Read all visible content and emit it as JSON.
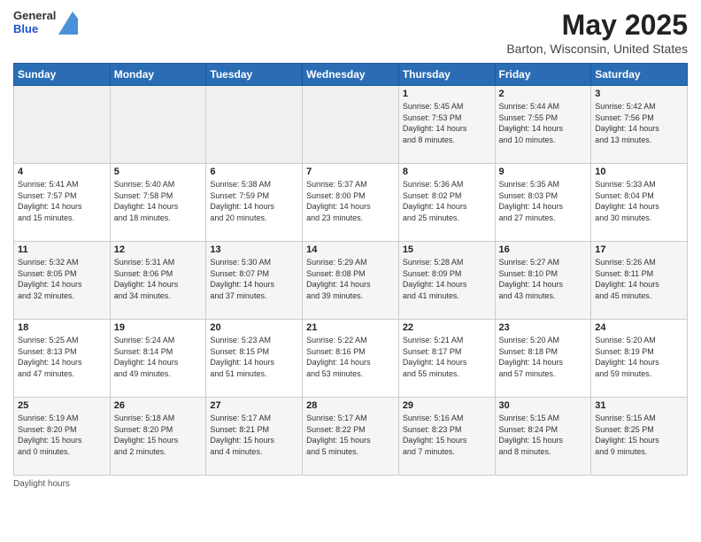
{
  "logo": {
    "general": "General",
    "blue": "Blue"
  },
  "title": "May 2025",
  "location": "Barton, Wisconsin, United States",
  "days_of_week": [
    "Sunday",
    "Monday",
    "Tuesday",
    "Wednesday",
    "Thursday",
    "Friday",
    "Saturday"
  ],
  "weeks": [
    [
      {
        "day": "",
        "info": ""
      },
      {
        "day": "",
        "info": ""
      },
      {
        "day": "",
        "info": ""
      },
      {
        "day": "",
        "info": ""
      },
      {
        "day": "1",
        "info": "Sunrise: 5:45 AM\nSunset: 7:53 PM\nDaylight: 14 hours\nand 8 minutes."
      },
      {
        "day": "2",
        "info": "Sunrise: 5:44 AM\nSunset: 7:55 PM\nDaylight: 14 hours\nand 10 minutes."
      },
      {
        "day": "3",
        "info": "Sunrise: 5:42 AM\nSunset: 7:56 PM\nDaylight: 14 hours\nand 13 minutes."
      }
    ],
    [
      {
        "day": "4",
        "info": "Sunrise: 5:41 AM\nSunset: 7:57 PM\nDaylight: 14 hours\nand 15 minutes."
      },
      {
        "day": "5",
        "info": "Sunrise: 5:40 AM\nSunset: 7:58 PM\nDaylight: 14 hours\nand 18 minutes."
      },
      {
        "day": "6",
        "info": "Sunrise: 5:38 AM\nSunset: 7:59 PM\nDaylight: 14 hours\nand 20 minutes."
      },
      {
        "day": "7",
        "info": "Sunrise: 5:37 AM\nSunset: 8:00 PM\nDaylight: 14 hours\nand 23 minutes."
      },
      {
        "day": "8",
        "info": "Sunrise: 5:36 AM\nSunset: 8:02 PM\nDaylight: 14 hours\nand 25 minutes."
      },
      {
        "day": "9",
        "info": "Sunrise: 5:35 AM\nSunset: 8:03 PM\nDaylight: 14 hours\nand 27 minutes."
      },
      {
        "day": "10",
        "info": "Sunrise: 5:33 AM\nSunset: 8:04 PM\nDaylight: 14 hours\nand 30 minutes."
      }
    ],
    [
      {
        "day": "11",
        "info": "Sunrise: 5:32 AM\nSunset: 8:05 PM\nDaylight: 14 hours\nand 32 minutes."
      },
      {
        "day": "12",
        "info": "Sunrise: 5:31 AM\nSunset: 8:06 PM\nDaylight: 14 hours\nand 34 minutes."
      },
      {
        "day": "13",
        "info": "Sunrise: 5:30 AM\nSunset: 8:07 PM\nDaylight: 14 hours\nand 37 minutes."
      },
      {
        "day": "14",
        "info": "Sunrise: 5:29 AM\nSunset: 8:08 PM\nDaylight: 14 hours\nand 39 minutes."
      },
      {
        "day": "15",
        "info": "Sunrise: 5:28 AM\nSunset: 8:09 PM\nDaylight: 14 hours\nand 41 minutes."
      },
      {
        "day": "16",
        "info": "Sunrise: 5:27 AM\nSunset: 8:10 PM\nDaylight: 14 hours\nand 43 minutes."
      },
      {
        "day": "17",
        "info": "Sunrise: 5:26 AM\nSunset: 8:11 PM\nDaylight: 14 hours\nand 45 minutes."
      }
    ],
    [
      {
        "day": "18",
        "info": "Sunrise: 5:25 AM\nSunset: 8:13 PM\nDaylight: 14 hours\nand 47 minutes."
      },
      {
        "day": "19",
        "info": "Sunrise: 5:24 AM\nSunset: 8:14 PM\nDaylight: 14 hours\nand 49 minutes."
      },
      {
        "day": "20",
        "info": "Sunrise: 5:23 AM\nSunset: 8:15 PM\nDaylight: 14 hours\nand 51 minutes."
      },
      {
        "day": "21",
        "info": "Sunrise: 5:22 AM\nSunset: 8:16 PM\nDaylight: 14 hours\nand 53 minutes."
      },
      {
        "day": "22",
        "info": "Sunrise: 5:21 AM\nSunset: 8:17 PM\nDaylight: 14 hours\nand 55 minutes."
      },
      {
        "day": "23",
        "info": "Sunrise: 5:20 AM\nSunset: 8:18 PM\nDaylight: 14 hours\nand 57 minutes."
      },
      {
        "day": "24",
        "info": "Sunrise: 5:20 AM\nSunset: 8:19 PM\nDaylight: 14 hours\nand 59 minutes."
      }
    ],
    [
      {
        "day": "25",
        "info": "Sunrise: 5:19 AM\nSunset: 8:20 PM\nDaylight: 15 hours\nand 0 minutes."
      },
      {
        "day": "26",
        "info": "Sunrise: 5:18 AM\nSunset: 8:20 PM\nDaylight: 15 hours\nand 2 minutes."
      },
      {
        "day": "27",
        "info": "Sunrise: 5:17 AM\nSunset: 8:21 PM\nDaylight: 15 hours\nand 4 minutes."
      },
      {
        "day": "28",
        "info": "Sunrise: 5:17 AM\nSunset: 8:22 PM\nDaylight: 15 hours\nand 5 minutes."
      },
      {
        "day": "29",
        "info": "Sunrise: 5:16 AM\nSunset: 8:23 PM\nDaylight: 15 hours\nand 7 minutes."
      },
      {
        "day": "30",
        "info": "Sunrise: 5:15 AM\nSunset: 8:24 PM\nDaylight: 15 hours\nand 8 minutes."
      },
      {
        "day": "31",
        "info": "Sunrise: 5:15 AM\nSunset: 8:25 PM\nDaylight: 15 hours\nand 9 minutes."
      }
    ]
  ],
  "footer": {
    "daylight_label": "Daylight hours"
  }
}
